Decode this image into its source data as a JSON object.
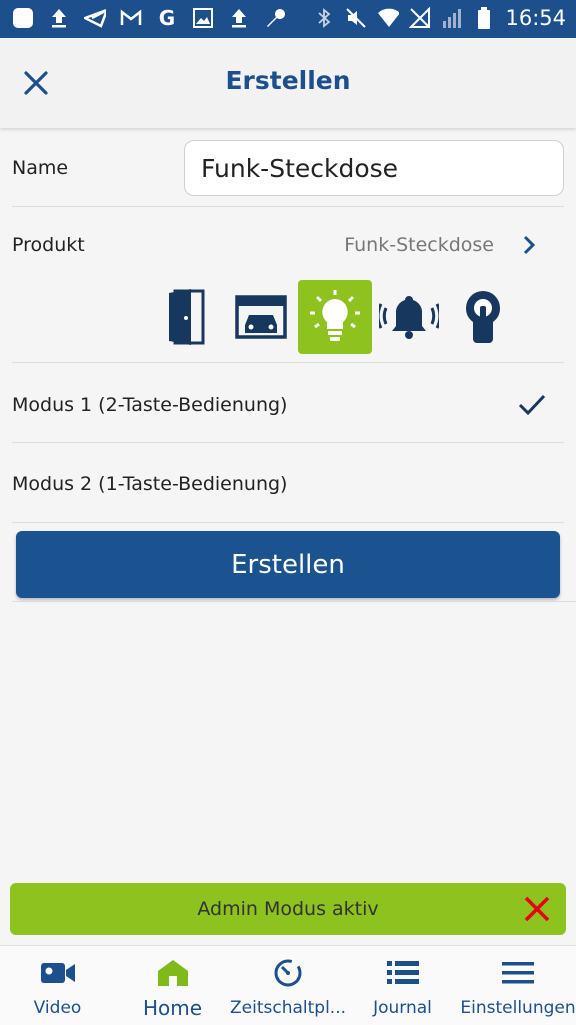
{
  "status_bar": {
    "time": "16:54"
  },
  "header": {
    "title": "Erstellen"
  },
  "form": {
    "name_label": "Name",
    "name_value": "Funk-Steckdose",
    "product_label": "Produkt",
    "product_value": "Funk-Steckdose",
    "product_icons": [
      "door-icon",
      "garage-icon",
      "light-bulb-icon",
      "bell-icon",
      "lock-cylinder-icon"
    ],
    "selected_icon": "light-bulb-icon",
    "modes": [
      {
        "label": "Modus 1 (2-Taste-Bedienung)",
        "selected": true
      },
      {
        "label": "Modus 2 (1-Taste-Bedienung)",
        "selected": false
      }
    ],
    "submit_label": "Erstellen"
  },
  "admin_banner": {
    "text": "Admin Modus aktiv"
  },
  "bottom_nav": {
    "items": [
      {
        "label": "Video",
        "icon": "video-camera-icon"
      },
      {
        "label": "Home",
        "icon": "home-icon"
      },
      {
        "label": "Zeitschaltpl...",
        "icon": "timer-icon"
      },
      {
        "label": "Journal",
        "icon": "list-icon"
      },
      {
        "label": "Einstellungen",
        "icon": "menu-icon"
      }
    ],
    "active": "Home"
  },
  "colors": {
    "primary": "#1c4f8c",
    "accent": "#8dc21f",
    "danger": "#e60012"
  }
}
